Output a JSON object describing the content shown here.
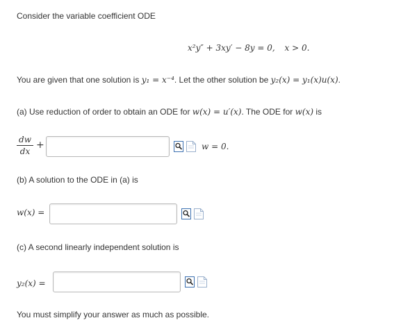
{
  "intro": {
    "text": "Consider the variable coefficient ODE"
  },
  "ode": {
    "equation": "x²y″ + 3xy′ − 8y = 0,",
    "condition": "x > 0."
  },
  "given": {
    "prefix": "You are given that one solution is ",
    "y1": "y₁ = x⁻⁴",
    "middle": ". Let the other solution be ",
    "y2": "y₂(x) = y₁(x)u(x)",
    "suffix": "."
  },
  "part_a": {
    "prompt_start": "(a) Use reduction of order to obtain an ODE for ",
    "w_def": "w(x) = u′(x)",
    "prompt_mid": ". The ODE for ",
    "w_of_x": "w(x)",
    "prompt_end": " is",
    "frac_num": "dw",
    "frac_den": "dx",
    "plus": "+",
    "tail": "w = 0.",
    "input_value": ""
  },
  "part_b": {
    "prompt": "(b) A solution to the ODE in (a) is",
    "label": "w(x) =",
    "input_value": ""
  },
  "part_c": {
    "prompt": "(c) A second linearly independent solution is",
    "label": "y₂(x) =",
    "input_value": ""
  },
  "footer": {
    "note": "You must simplify your answer as much as possible."
  },
  "icons": {
    "preview": "magnifier-preview-icon",
    "help": "document-help-icon"
  },
  "colors": {
    "text": "#333333",
    "math": "#333333",
    "border": "#b8b8b8",
    "icon_blue": "#3a6fb0"
  }
}
